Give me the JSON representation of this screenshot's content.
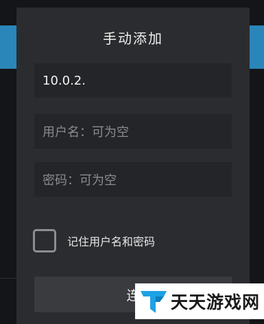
{
  "dialog": {
    "title": "手动添加",
    "ip_value": "10.0.2.",
    "username_placeholder": "用户名：可为空",
    "password_placeholder": "密码：可为空",
    "remember_label": "记住用户名和密码",
    "remember_checked": false,
    "connect_label": "连"
  },
  "watermark": {
    "text": "天天游戏网"
  },
  "colors": {
    "dialog_bg": "#2b2c2f",
    "field_bg": "#242528",
    "accent_band": "#2a86b8",
    "logo_primary": "#1da1e6"
  }
}
